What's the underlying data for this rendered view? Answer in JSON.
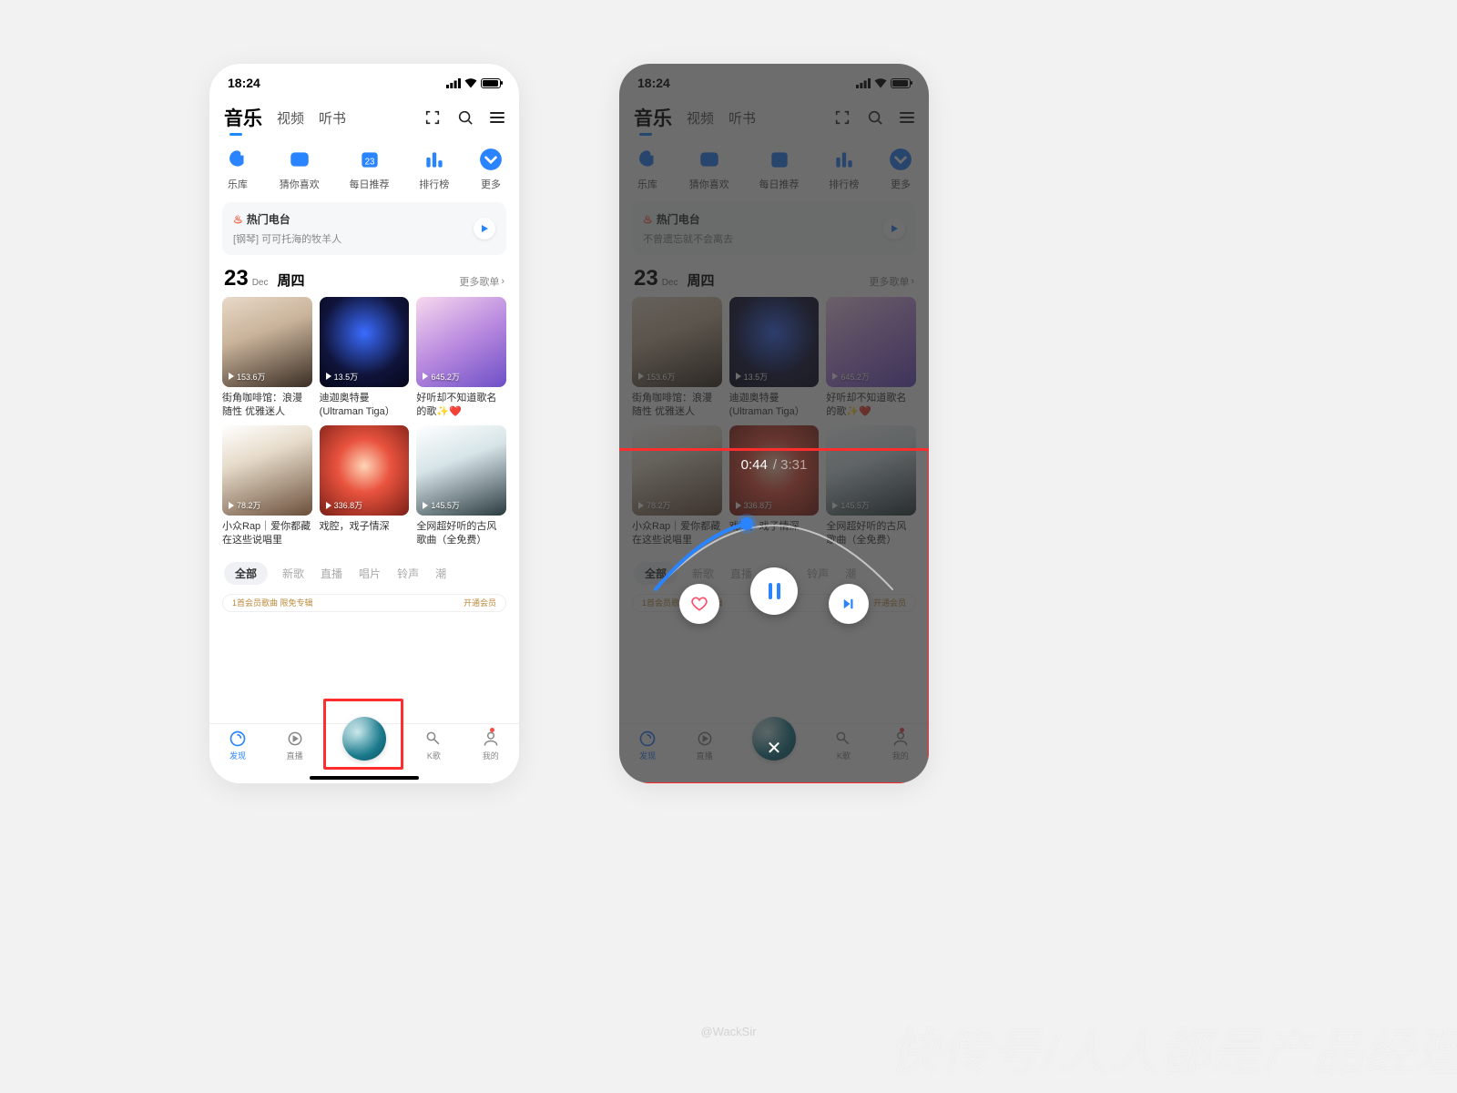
{
  "status": {
    "time": "18:24"
  },
  "top_tabs": {
    "music": "音乐",
    "video": "视频",
    "audiobook": "听书"
  },
  "quick": {
    "library": "乐库",
    "guess": "猜你喜欢",
    "daily": "每日推荐",
    "charts": "排行榜",
    "more": "更多"
  },
  "radio": {
    "title": "热门电台",
    "sub_left": "[钢琴] 可可托海的牧羊人",
    "sub_right": "不曾遗忘就不会离去"
  },
  "date": {
    "day": "23",
    "month": "Dec",
    "weekday": "周四",
    "more": "更多歌单"
  },
  "cards": [
    {
      "plays": "153.6万",
      "title": "街角咖啡馆：浪漫随性 优雅迷人"
    },
    {
      "plays": "13.5万",
      "title": "迪迦奥特曼 (Ultraman Tiga）"
    },
    {
      "plays": "645.2万",
      "title": "好听却不知道歌名的歌✨❤️"
    },
    {
      "plays": "78.2万",
      "title": "小众Rap｜爱你都藏在这些说唱里"
    },
    {
      "plays": "336.8万",
      "title": "戏腔，戏子情深"
    },
    {
      "plays": "145.5万",
      "title": "全网超好听的古风歌曲（全免费）"
    }
  ],
  "pills": {
    "all": "全部",
    "new": "新歌",
    "live": "直播",
    "album": "唱片",
    "ring": "铃声",
    "trend": "潮"
  },
  "banner": {
    "left": "1首会员歌曲 限免专辑",
    "right": "开通会员"
  },
  "tabbar": {
    "discover": "发现",
    "live": "直播",
    "k": "K歌",
    "me": "我的"
  },
  "player": {
    "cur": "0:44",
    "sep": "/",
    "total": "3:31"
  },
  "watermark": "快传号/人人都是产品经理",
  "wm2": "@WackSir"
}
